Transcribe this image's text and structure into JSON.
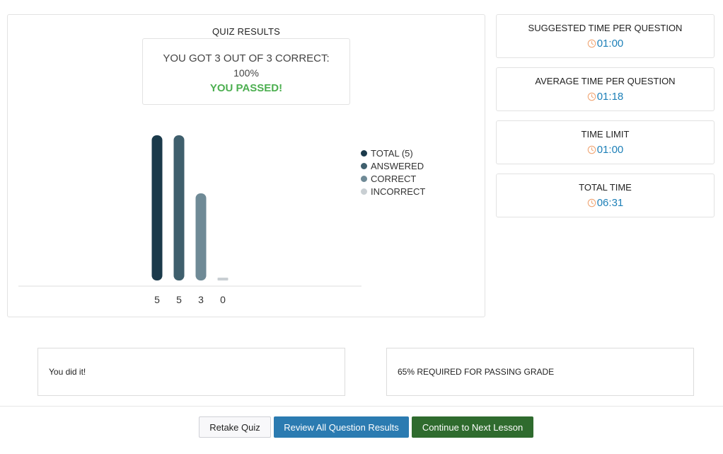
{
  "results": {
    "title": "QUIZ RESULTS",
    "score_line": "YOU GOT 3 OUT OF 3 CORRECT:",
    "score_percent": "100%",
    "status": "YOU PASSED!"
  },
  "chart_data": {
    "type": "bar",
    "categories": [
      "TOTAL (5)",
      "ANSWERED",
      "CORRECT",
      "INCORRECT"
    ],
    "values": [
      5,
      5,
      3,
      0
    ],
    "value_labels": [
      "5",
      "5",
      "3",
      "0"
    ],
    "colors": [
      "#1b3a4b",
      "#3f5f6d",
      "#6f8a96",
      "#c9cfd3"
    ],
    "ylim": [
      0,
      5
    ],
    "legend_position": "right",
    "grid": false
  },
  "timings": [
    {
      "label": "SUGGESTED TIME PER QUESTION",
      "value": "01:00"
    },
    {
      "label": "AVERAGE TIME PER QUESTION",
      "value": "01:18"
    },
    {
      "label": "TIME LIMIT",
      "value": "01:00"
    },
    {
      "label": "TOTAL TIME",
      "value": "06:31"
    }
  ],
  "messages": {
    "feedback": "You did it!",
    "requirement": "65% REQUIRED FOR PASSING GRADE"
  },
  "buttons": {
    "retake": "Retake Quiz",
    "review": "Review All Question Results",
    "continue": "Continue to Next Lesson"
  },
  "colors": {
    "accent_blue": "#1e80b8",
    "pass_green": "#4caf50",
    "clock_orange": "#f0a878"
  },
  "icons": {
    "timer": "clock-icon"
  }
}
